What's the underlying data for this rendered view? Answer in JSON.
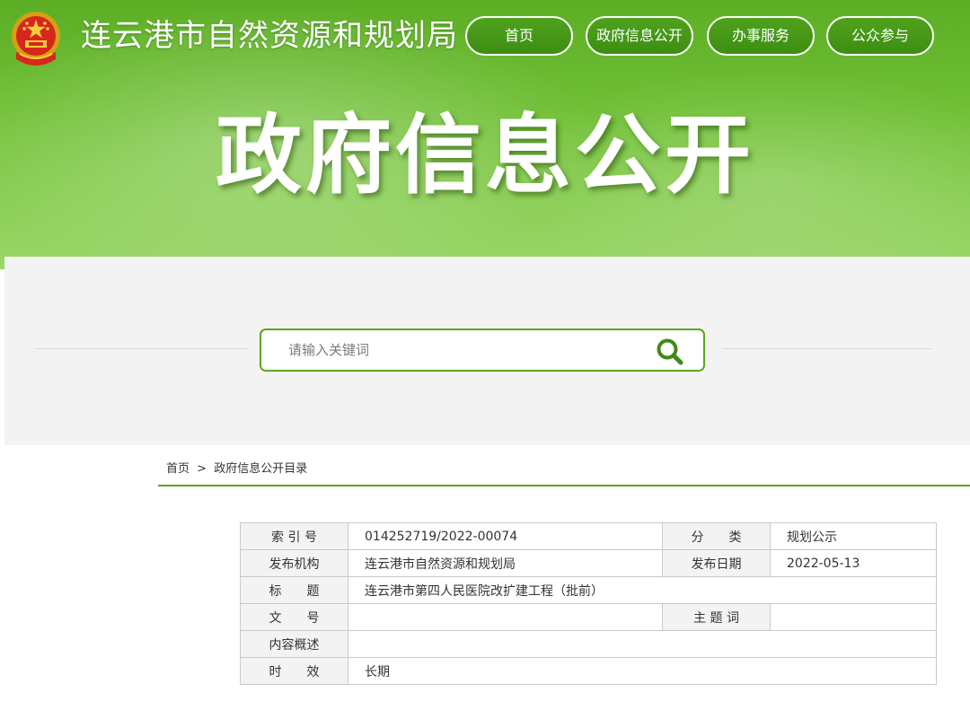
{
  "header": {
    "site_title": "连云港市自然资源和规划局",
    "emblem_icon": "national-emblem-icon",
    "nav": [
      {
        "label": "首页"
      },
      {
        "label": "政府信息公开"
      },
      {
        "label": "办事服务"
      },
      {
        "label": "公众参与"
      }
    ],
    "hero_title": "政府信息公开"
  },
  "search": {
    "placeholder": "请输入关键词",
    "value": "",
    "icon": "search-icon"
  },
  "breadcrumb": {
    "home": "首页",
    "separator": ">",
    "current": "政府信息公开目录"
  },
  "info": {
    "index_label": "索 引 号",
    "index_value": "014252719/2022-00074",
    "category_label": "分　　类",
    "category_value": "规划公示",
    "publisher_label": "发布机构",
    "publisher_value": "连云港市自然资源和规划局",
    "date_label": "发布日期",
    "date_value": "2022-05-13",
    "title_label": "标　　题",
    "title_value": "连云港市第四人民医院改扩建工程（批前）",
    "docno_label": "文　　号",
    "docno_value": "",
    "keywords_label": "主 题 词",
    "keywords_value": "",
    "summary_label": "内容概述",
    "summary_value": "",
    "validity_label": "时　　效",
    "validity_value": "长期"
  },
  "colors": {
    "brand_green": "#5aa61f",
    "banner_top": "#5cae24",
    "banner_bottom": "#9bd66a",
    "nav_button": "#3d8e12"
  }
}
